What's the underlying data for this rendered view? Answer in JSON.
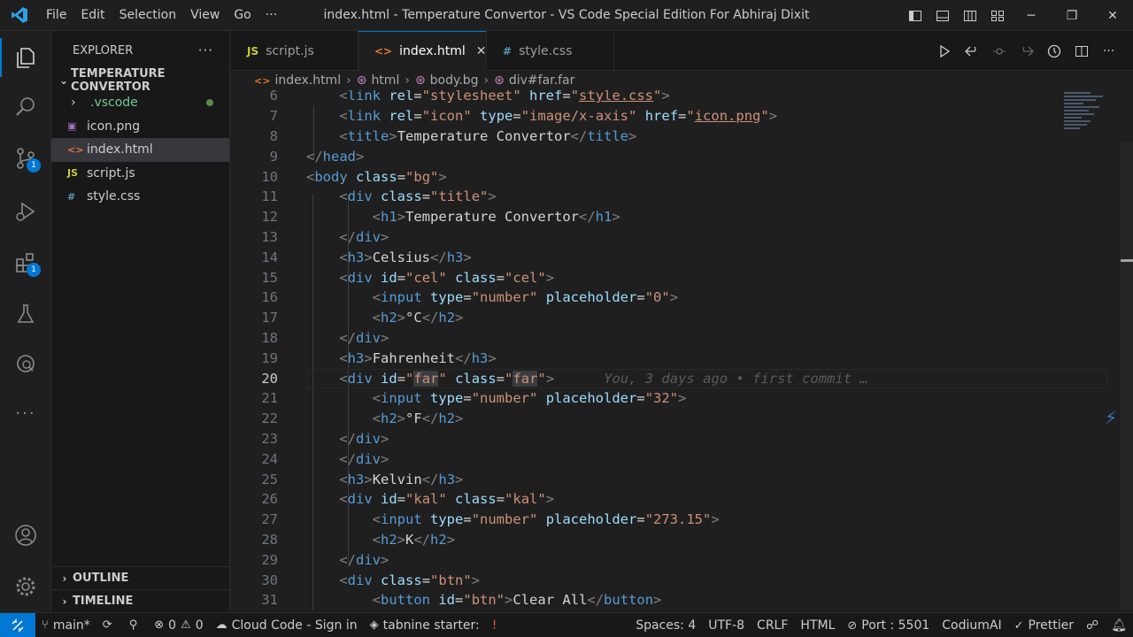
{
  "titlebar": {
    "menu": [
      "File",
      "Edit",
      "Selection",
      "View",
      "Go"
    ],
    "more": "···",
    "title": "index.html - Temperature Convertor - VS Code Special Edition For Abhiraj Dixit"
  },
  "activity": {
    "source_control_badge": "1",
    "extensions_badge": "1"
  },
  "sidebar": {
    "header": "EXPLORER",
    "header_more": "···",
    "folder": "TEMPERATURE CONVERTOR",
    "files": [
      {
        "icon": "›",
        "name": ".vscode"
      },
      {
        "icon": "▣",
        "name": "icon.png"
      },
      {
        "icon": "<>",
        "name": "index.html"
      },
      {
        "icon": "JS",
        "name": "script.js"
      },
      {
        "icon": "#",
        "name": "style.css"
      }
    ],
    "outline": "OUTLINE",
    "timeline": "TIMELINE"
  },
  "tabs": [
    {
      "icon": "JS",
      "label": "script.js"
    },
    {
      "icon": "<>",
      "label": "index.html",
      "close": "✕"
    },
    {
      "icon": "#",
      "label": "style.css"
    }
  ],
  "breadcrumb": [
    "index.html",
    "html",
    "body.bg",
    "div#far.far"
  ],
  "editor": {
    "lines": [
      "6",
      "7",
      "8",
      "9",
      "10",
      "11",
      "12",
      "13",
      "14",
      "15",
      "16",
      "17",
      "18",
      "19",
      "20",
      "21",
      "22",
      "23",
      "24",
      "25",
      "26",
      "27",
      "28",
      "29",
      "30",
      "31"
    ],
    "blame": "You, 3 days ago • first commit …"
  },
  "status": {
    "branch": "main*",
    "errors": "0",
    "warnings": "0",
    "cloud": "Cloud Code - Sign in",
    "tabnine": "tabnine starter:",
    "spaces": "Spaces: 4",
    "encoding": "UTF-8",
    "eol": "CRLF",
    "language": "HTML",
    "port": "Port : 5501",
    "codium": "CodiumAI",
    "prettier": "Prettier"
  },
  "colors": {
    "accent": "#0078d4",
    "bg": "#1f1f1f",
    "sidebar": "#181818"
  }
}
